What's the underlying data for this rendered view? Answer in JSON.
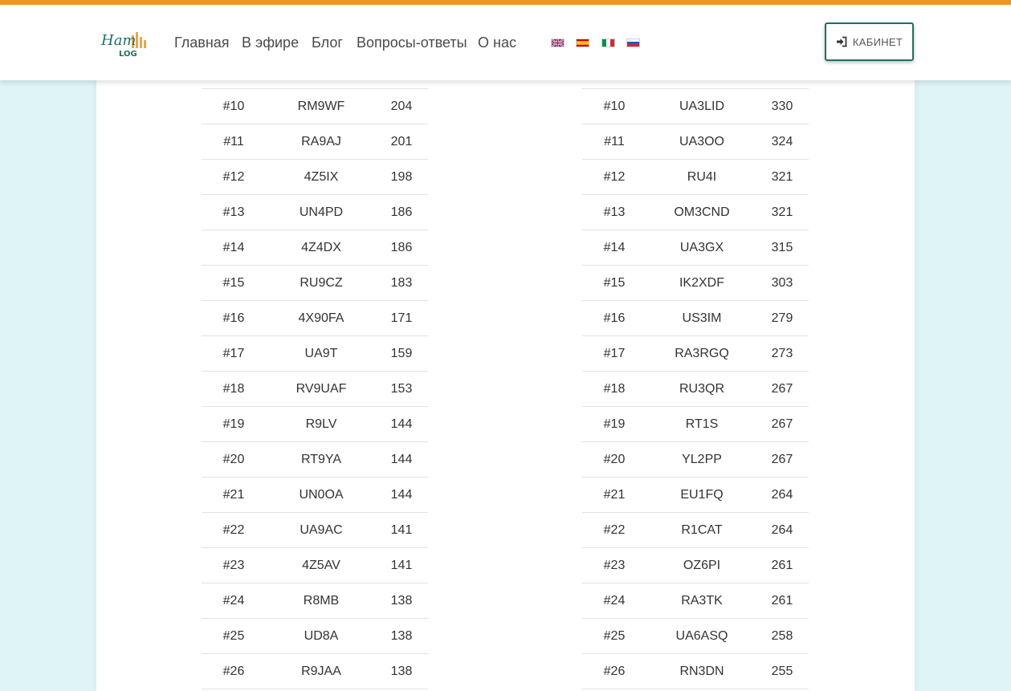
{
  "nav": {
    "logo_text": "Ham LOG",
    "links": [
      "Главная",
      "В эфире",
      "Блог",
      "Вопросы-ответы",
      "О нас"
    ],
    "languages": [
      "english-flag-icon",
      "spanish-flag-icon",
      "italian-flag-icon",
      "russian-flag-icon"
    ],
    "cabinet_label": "КАБИНЕТ"
  },
  "colors": {
    "accent": "#f39422",
    "button_border": "#1f6f62",
    "background": "#dff4f6"
  },
  "left_table": [
    {
      "rank": "#10",
      "callsign": "RM9WF",
      "value": "204"
    },
    {
      "rank": "#11",
      "callsign": "RA9AJ",
      "value": "201"
    },
    {
      "rank": "#12",
      "callsign": "4Z5IX",
      "value": "198"
    },
    {
      "rank": "#13",
      "callsign": "UN4PD",
      "value": "186"
    },
    {
      "rank": "#14",
      "callsign": "4Z4DX",
      "value": "186"
    },
    {
      "rank": "#15",
      "callsign": "RU9CZ",
      "value": "183"
    },
    {
      "rank": "#16",
      "callsign": "4X90FA",
      "value": "171"
    },
    {
      "rank": "#17",
      "callsign": "UA9T",
      "value": "159"
    },
    {
      "rank": "#18",
      "callsign": "RV9UAF",
      "value": "153"
    },
    {
      "rank": "#19",
      "callsign": "R9LV",
      "value": "144"
    },
    {
      "rank": "#20",
      "callsign": "RT9YA",
      "value": "144"
    },
    {
      "rank": "#21",
      "callsign": "UN0OA",
      "value": "144"
    },
    {
      "rank": "#22",
      "callsign": "UA9AC",
      "value": "141"
    },
    {
      "rank": "#23",
      "callsign": "4Z5AV",
      "value": "141"
    },
    {
      "rank": "#24",
      "callsign": "R8MB",
      "value": "138"
    },
    {
      "rank": "#25",
      "callsign": "UD8A",
      "value": "138"
    },
    {
      "rank": "#26",
      "callsign": "R9JAA",
      "value": "138"
    }
  ],
  "right_table": [
    {
      "rank": "#10",
      "callsign": "UA3LID",
      "value": "330"
    },
    {
      "rank": "#11",
      "callsign": "UA3OO",
      "value": "324"
    },
    {
      "rank": "#12",
      "callsign": "RU4I",
      "value": "321"
    },
    {
      "rank": "#13",
      "callsign": "OM3CND",
      "value": "321"
    },
    {
      "rank": "#14",
      "callsign": "UA3GX",
      "value": "315"
    },
    {
      "rank": "#15",
      "callsign": "IK2XDF",
      "value": "303"
    },
    {
      "rank": "#16",
      "callsign": "US3IM",
      "value": "279"
    },
    {
      "rank": "#17",
      "callsign": "RA3RGQ",
      "value": "273"
    },
    {
      "rank": "#18",
      "callsign": "RU3QR",
      "value": "267"
    },
    {
      "rank": "#19",
      "callsign": "RT1S",
      "value": "267"
    },
    {
      "rank": "#20",
      "callsign": "YL2PP",
      "value": "267"
    },
    {
      "rank": "#21",
      "callsign": "EU1FQ",
      "value": "264"
    },
    {
      "rank": "#22",
      "callsign": "R1CAT",
      "value": "264"
    },
    {
      "rank": "#23",
      "callsign": "OZ6PI",
      "value": "261"
    },
    {
      "rank": "#24",
      "callsign": "RA3TK",
      "value": "261"
    },
    {
      "rank": "#25",
      "callsign": "UA6ASQ",
      "value": "258"
    },
    {
      "rank": "#26",
      "callsign": "RN3DN",
      "value": "255"
    }
  ]
}
